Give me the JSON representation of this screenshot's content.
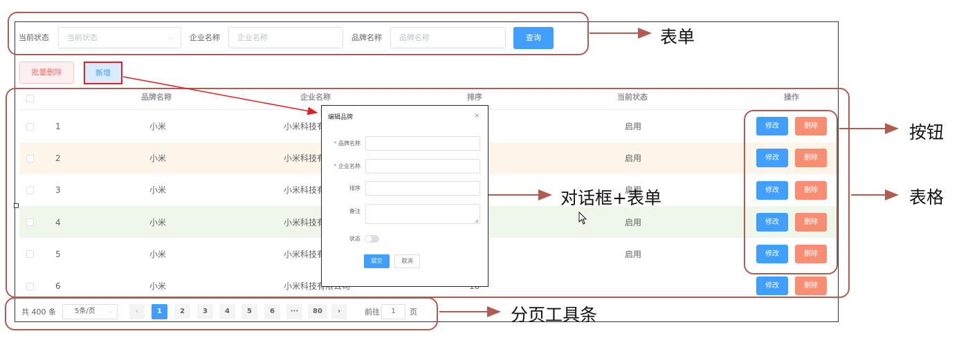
{
  "search": {
    "status_label": "当前状态",
    "status_placeholder": "当前状态",
    "company_label": "企业名称",
    "company_placeholder": "企业名称",
    "brand_label": "品牌名称",
    "brand_placeholder": "品牌名称",
    "query_label": "查询"
  },
  "actions": {
    "batch_delete_label": "批量删除",
    "add_label": "新增"
  },
  "table": {
    "headers": [
      "品牌名称",
      "企业名称",
      "排序",
      "当前状态",
      "操作"
    ],
    "rows": [
      {
        "index": "1",
        "brand": "小米",
        "company": "小米科技有",
        "sort": "",
        "status": "启用"
      },
      {
        "index": "2",
        "brand": "小米",
        "company": "小米科技有",
        "sort": "",
        "status": "启用"
      },
      {
        "index": "3",
        "brand": "小米",
        "company": "小米科技有",
        "sort": "",
        "status": "启用"
      },
      {
        "index": "4",
        "brand": "小米",
        "company": "小米科技有",
        "sort": "",
        "status": "启用"
      },
      {
        "index": "5",
        "brand": "小米",
        "company": "小米科技有",
        "sort": "",
        "status": "启用"
      },
      {
        "index": "6",
        "brand": "小米",
        "company": "小米科技有限公司",
        "sort": "10",
        "status": ""
      }
    ],
    "edit_label": "修改",
    "delete_label": "删除"
  },
  "dialog": {
    "title": "编辑品牌",
    "close": "×",
    "brand_label": "品牌名称",
    "company_label": "企业名称",
    "sort_label": "排序",
    "remark_label": "备注",
    "status_label": "状态",
    "submit_label": "提交",
    "cancel_label": "取消"
  },
  "pagination": {
    "total": "共 400 条",
    "page_size": "5条/页",
    "pages": [
      "1",
      "2",
      "3",
      "4",
      "5",
      "6",
      "···",
      "80"
    ],
    "current": "1",
    "goto_prefix": "前往",
    "goto_value": "1",
    "goto_suffix": "页"
  },
  "annotations": {
    "form": "表单",
    "buttons": "按钮",
    "dialog_form": "对话框+表单",
    "table": "表格",
    "pagination": "分页工具条"
  },
  "colors": {
    "primary": "#409eff",
    "danger": "#f88d71",
    "annotation": "#b05a50",
    "arrow_red": "#e02020"
  }
}
